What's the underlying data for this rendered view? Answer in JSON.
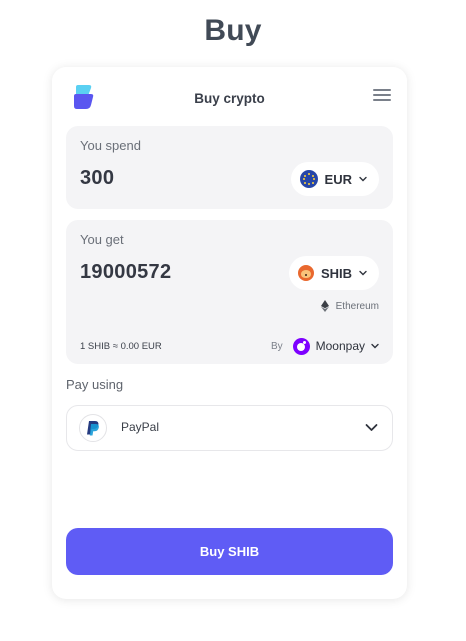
{
  "page": {
    "title": "Buy"
  },
  "header": {
    "title": "Buy crypto",
    "logo_icon": "app-logo-icon",
    "menu_icon": "hamburger-menu-icon"
  },
  "spend": {
    "label": "You spend",
    "amount": "300",
    "currency": "EUR",
    "currency_icon": "eu-flag-icon"
  },
  "get": {
    "label": "You get",
    "amount": "19000572",
    "currency": "SHIB",
    "currency_icon": "shiba-inu-icon",
    "network": "Ethereum",
    "network_icon": "ethereum-icon"
  },
  "rate": {
    "text": "1 SHIB ≈ 0.00 EUR"
  },
  "provider": {
    "by_label": "By",
    "name": "Moonpay",
    "icon": "moonpay-icon"
  },
  "payment": {
    "label": "Pay using",
    "method": "PayPal",
    "icon": "paypal-icon"
  },
  "action": {
    "buy_label": "Buy SHIB"
  },
  "colors": {
    "accent": "#5f5cf5",
    "panel_bg": "#f4f4f6",
    "moonpay": "#7d00ff",
    "shib": "#e9682e",
    "eur": "#2646a8"
  }
}
